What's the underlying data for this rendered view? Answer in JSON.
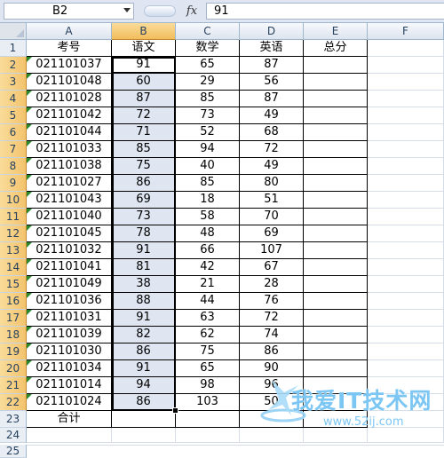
{
  "formula_bar": {
    "name_box": "B2",
    "fx": "fx",
    "value": "91"
  },
  "columns": [
    "A",
    "B",
    "C",
    "D",
    "E",
    "F"
  ],
  "row_numbers": [
    "1",
    "2",
    "3",
    "4",
    "5",
    "6",
    "7",
    "8",
    "9",
    "10",
    "11",
    "12",
    "13",
    "14",
    "15",
    "16",
    "17",
    "18",
    "19",
    "20",
    "21",
    "22",
    "23",
    "24",
    "25"
  ],
  "headers": [
    "考号",
    "语文",
    "数学",
    "英语",
    "总分"
  ],
  "rows": [
    [
      "021101037",
      "91",
      "65",
      "87",
      ""
    ],
    [
      "021101048",
      "60",
      "29",
      "56",
      ""
    ],
    [
      "021101028",
      "87",
      "85",
      "87",
      ""
    ],
    [
      "021101042",
      "72",
      "73",
      "49",
      ""
    ],
    [
      "021101044",
      "71",
      "52",
      "68",
      ""
    ],
    [
      "021101033",
      "85",
      "94",
      "72",
      ""
    ],
    [
      "021101038",
      "75",
      "40",
      "49",
      ""
    ],
    [
      "021101027",
      "86",
      "85",
      "80",
      ""
    ],
    [
      "021101043",
      "69",
      "18",
      "51",
      ""
    ],
    [
      "021101040",
      "73",
      "58",
      "70",
      ""
    ],
    [
      "021101045",
      "78",
      "48",
      "69",
      ""
    ],
    [
      "021101032",
      "91",
      "66",
      "107",
      ""
    ],
    [
      "021101041",
      "81",
      "42",
      "67",
      ""
    ],
    [
      "021101049",
      "38",
      "21",
      "28",
      ""
    ],
    [
      "021101036",
      "88",
      "44",
      "76",
      ""
    ],
    [
      "021101031",
      "91",
      "63",
      "72",
      ""
    ],
    [
      "021101039",
      "82",
      "62",
      "74",
      ""
    ],
    [
      "021101030",
      "86",
      "75",
      "86",
      ""
    ],
    [
      "021101034",
      "91",
      "65",
      "90",
      ""
    ],
    [
      "021101014",
      "94",
      "98",
      "96",
      ""
    ],
    [
      "021101024",
      "86",
      "103",
      "50",
      ""
    ]
  ],
  "total_row": [
    "合计",
    "",
    "",
    "",
    ""
  ],
  "watermark": {
    "text": "我爱IT技术网",
    "url": "www.52ij.com"
  }
}
